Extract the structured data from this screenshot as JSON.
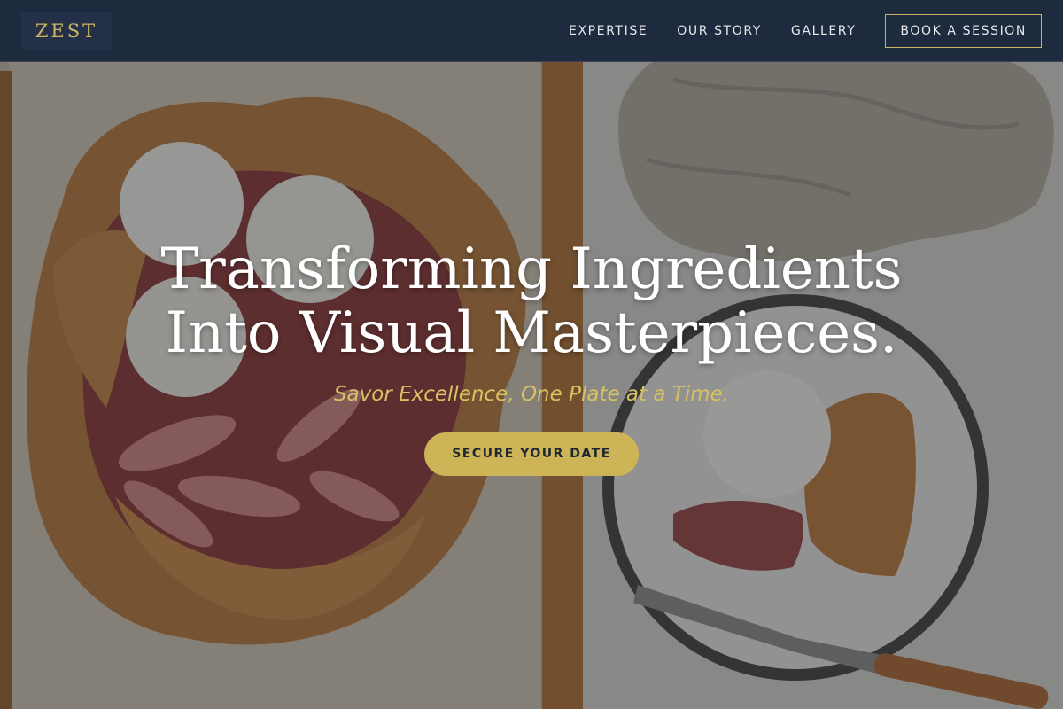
{
  "brand": {
    "logo_text": "ZEST"
  },
  "nav": {
    "links": [
      "EXPERTISE",
      "OUR STORY",
      "GALLERY"
    ],
    "cta_label": "BOOK A SESSION"
  },
  "hero": {
    "headline_line1": "Transforming Ingredients",
    "headline_line2": "Into Visual Masterpieces.",
    "tagline": "Savor Excellence, One Plate at a Time.",
    "button_label": "SECURE YOUR DATE",
    "background_image": "food-photo-galette-with-ice-cream"
  },
  "colors": {
    "nav_background": "#1e2a3d",
    "accent_gold": "#cdb557",
    "tagline_gold": "#d8c163",
    "headline_white": "#ffffff"
  }
}
